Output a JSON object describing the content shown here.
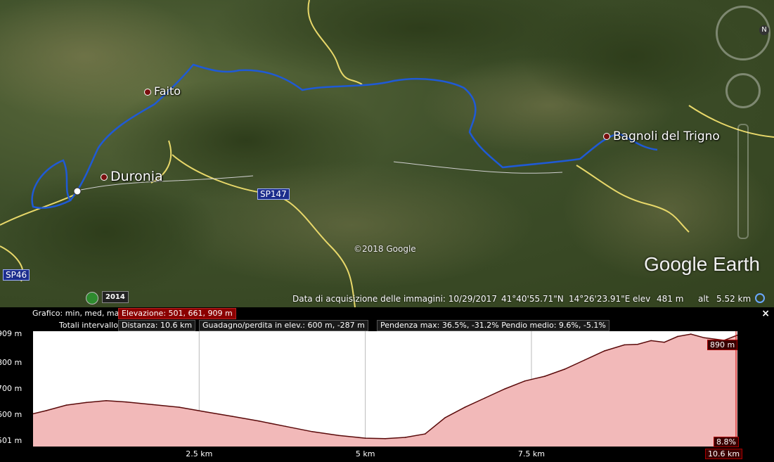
{
  "map": {
    "places": [
      {
        "name": "Faito"
      },
      {
        "name": "Duronia"
      },
      {
        "name": "Bagnoli del Trigno"
      }
    ],
    "roads": [
      "SP147",
      "SP46"
    ],
    "copyright": "©2018 Google",
    "logo": "Google Earth",
    "year_badge": "2014"
  },
  "statusbar": {
    "acquisition": "Data di acquisizione delle immagini: 10/29/2017",
    "lat": "41°40'55.71\"N",
    "lon": "14°26'23.91\"E",
    "elev_label": "elev",
    "elev_value": "481 m",
    "alt_label": "alt",
    "alt_value": "5.52 km"
  },
  "nav": {
    "north": "N"
  },
  "profile": {
    "graph_label": "Grafico: min, med, max",
    "elevation": "Elevazione: 501, 661, 909 m",
    "totals_label": "Totali intervallo:",
    "distance": "Distanza: 10.6 km",
    "gain_loss": "Guadagno/perdita in elev.: 600 m, -287 m",
    "slope": "Pendenza max: 36.5%, -31.2% Pendio medio: 9.6%, -5.1%",
    "close": "×",
    "cursor_elev": "890 m",
    "cursor_slope": "8.8%",
    "cursor_dist": "10.6 km"
  },
  "chart_data": {
    "type": "area",
    "xlabel": "",
    "ylabel": "",
    "xlim": [
      0,
      10.6
    ],
    "ylim": [
      480,
      920
    ],
    "x_ticks": [
      "2.5 km",
      "5 km",
      "7.5 km"
    ],
    "x_tick_values": [
      2.5,
      5,
      7.5
    ],
    "y_ticks": [
      "909 m",
      "800 m",
      "700 m",
      "600 m",
      "501 m"
    ],
    "y_tick_values": [
      909,
      800,
      700,
      600,
      501
    ],
    "fill_color": "#f2b9b9",
    "line_color": "#5a0a0a",
    "series": [
      {
        "x": [
          0,
          0.2,
          0.5,
          0.8,
          1.1,
          1.4,
          1.8,
          2.2,
          2.6,
          3.0,
          3.4,
          3.8,
          4.2,
          4.6,
          5.0,
          5.3,
          5.6,
          5.9,
          6.2,
          6.5,
          6.8,
          7.1,
          7.4,
          7.7,
          8.0,
          8.3,
          8.6,
          8.9,
          9.1,
          9.3,
          9.5,
          9.7,
          9.9,
          10.1,
          10.4,
          10.6
        ],
        "y": [
          605,
          617,
          638,
          648,
          655,
          650,
          640,
          630,
          612,
          595,
          577,
          557,
          537,
          522,
          512,
          510,
          515,
          528,
          590,
          630,
          665,
          700,
          730,
          748,
          775,
          810,
          845,
          868,
          870,
          884,
          878,
          900,
          909,
          895,
          885,
          905
        ]
      }
    ]
  }
}
